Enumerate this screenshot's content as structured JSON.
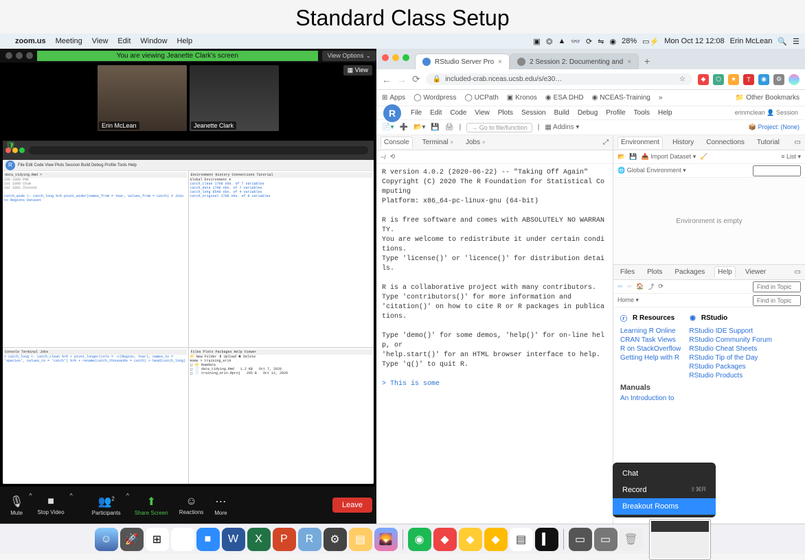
{
  "page_title": "Standard Class Setup",
  "menubar": {
    "app": "zoom.us",
    "items": [
      "Meeting",
      "View",
      "Edit",
      "Window",
      "Help"
    ],
    "battery": "28%",
    "datetime": "Mon Oct 12  12:08",
    "user": "Erin McLean"
  },
  "zoom": {
    "sharing_banner": "You are viewing Jeanette Clark's screen",
    "view_options": "View Options",
    "view_badge": "View",
    "participants": [
      {
        "name": "Erin McLean"
      },
      {
        "name": "Jeanette Clark"
      }
    ],
    "toolbar": {
      "mute": "Mute",
      "stop_video": "Stop Video",
      "participants": "Participants",
      "participants_count": "2",
      "share": "Share Screen",
      "reactions": "Reactions",
      "more": "More",
      "leave": "Leave"
    },
    "more_menu": {
      "chat": "Chat",
      "record": "Record",
      "record_kbd": "⇧⌘R",
      "breakout": "Breakout Rooms"
    }
  },
  "browser": {
    "tabs": [
      {
        "title": "RStudio Server Pro"
      },
      {
        "title": "2 Session 2: Documenting and"
      }
    ],
    "url": "included-crab.nceas.ucsb.edu/s/e30…",
    "bookmarks": {
      "apps": "Apps",
      "items": [
        "Wordpress",
        "UCPath",
        "Kronos",
        "ESA DHD",
        "NCEAS-Training"
      ],
      "other": "Other Bookmarks"
    }
  },
  "rstudio": {
    "menu": [
      "File",
      "Edit",
      "Code",
      "View",
      "Plots",
      "Session",
      "Build",
      "Debug",
      "Profile",
      "Tools",
      "Help"
    ],
    "user": "erinmclean",
    "session_label": "Session",
    "goto_placeholder": "Go to file/function",
    "addins": "Addins",
    "project": "Project: (None)",
    "console_tabs": {
      "console": "Console",
      "terminal": "Terminal",
      "jobs": "Jobs"
    },
    "console_path": "~/",
    "console_text": "R version 4.0.2 (2020-06-22) -- \"Taking Off Again\"\nCopyright (C) 2020 The R Foundation for Statistical Co\nmputing\nPlatform: x86_64-pc-linux-gnu (64-bit)\n\nR is free software and comes with ABSOLUTELY NO WARRAN\nTY.\nYou are welcome to redistribute it under certain condi\ntions.\nType 'license()' or 'licence()' for distribution detai\nls.\n\nR is a collaborative project with many contributors.\nType 'contributors()' for more information and\n'citation()' on how to cite R or R packages in publica\ntions.\n\nType 'demo()' for some demos, 'help()' for on-line hel\np, or\n'help.start()' for an HTML browser interface to help.\nType 'q()' to quit R.\n",
    "console_prompt": "> This is some",
    "env_tabs": {
      "env": "Environment",
      "history": "History",
      "conn": "Connections",
      "tut": "Tutorial"
    },
    "env_tools": {
      "import": "Import Dataset",
      "list": "List",
      "global": "Global Environment"
    },
    "env_empty": "Environment is empty",
    "help_tabs": {
      "files": "Files",
      "plots": "Plots",
      "packages": "Packages",
      "help": "Help",
      "viewer": "Viewer"
    },
    "help_home": "Home",
    "help_find": "Find in Topic",
    "help_heading_left": "R Resources",
    "help_heading_right": "RStudio",
    "help_links_left": [
      "Learning R Online",
      "CRAN Task Views",
      "R on StackOverflow",
      "Getting Help with R"
    ],
    "help_links_right": [
      "RStudio IDE Support",
      "RStudio Community Forum",
      "RStudio Cheat Sheets",
      "RStudio Tip of the Day",
      "RStudio Packages",
      "RStudio Products"
    ],
    "help_manuals": "Manuals",
    "help_manual_1": "An Introduction to"
  },
  "mini": {
    "tabs": [
      "Console",
      "Terminal",
      "Jobs"
    ],
    "code_lines": "catch_wide <- catch_long %>%\n  pivot_wider(names_from = Year, values_from = catch)\n\n# Join to Regions Dataset",
    "console_lines": "> catch_long <- catch_clean %>%\n+   pivot_longer(cols = -c(Region, Year), names_to = 'species', values_to = 'catch') %>%\n+   rename(catch_thousands = catch)\n> head(catch_long)",
    "env_rows": [
      "catch_clean    1708 obs. of 7 variables",
      "catch_data     1708 obs. of 7 variables",
      "catch_long     8540 obs. of 4 variables",
      "catch_original 1708 obs. of 9 variables"
    ],
    "files": [
      {
        "name": "Rawdata",
        "size": "",
        "date": ""
      },
      {
        "name": "data_tidying.Rmd",
        "size": "1.2 KB",
        "date": "Oct 7, 2020"
      },
      {
        "name": "training_erin.Rproj",
        "size": "205 B",
        "date": "Oct 12, 2020"
      }
    ]
  }
}
